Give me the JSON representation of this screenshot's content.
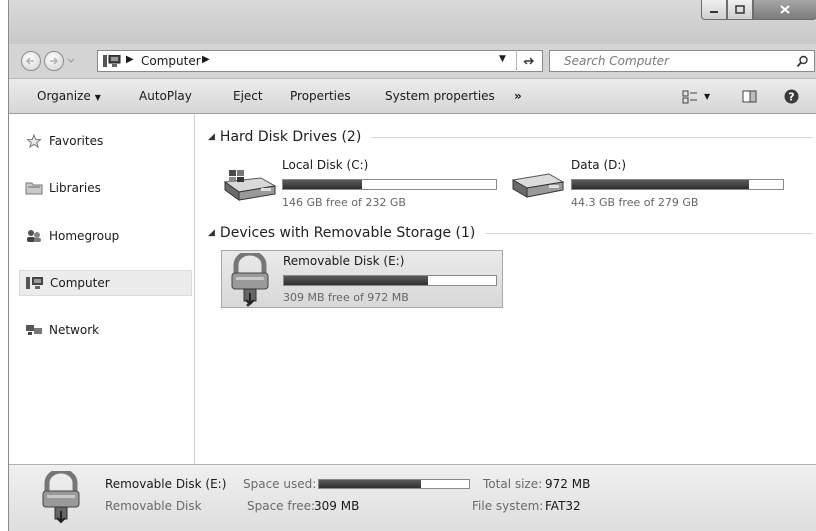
{
  "address_bar": {
    "path": [
      "Computer"
    ],
    "search_placeholder": "Search Computer"
  },
  "toolbar": {
    "organize": "Organize",
    "autoplay": "AutoPlay",
    "eject": "Eject",
    "properties": "Properties",
    "system_properties": "System properties",
    "more": "»"
  },
  "sidebar": {
    "items": [
      {
        "label": "Favorites",
        "icon": "star-icon"
      },
      {
        "label": "Libraries",
        "icon": "library-icon"
      },
      {
        "label": "Homegroup",
        "icon": "homegroup-icon"
      },
      {
        "label": "Computer",
        "icon": "computer-icon",
        "selected": true
      },
      {
        "label": "Network",
        "icon": "network-icon"
      }
    ]
  },
  "groups": [
    {
      "title": "Hard Disk Drives (2)",
      "drives": [
        {
          "name": "Local Disk (C:)",
          "free_text": "146 GB free of 232 GB",
          "used_fraction": 0.37,
          "icon": "windows-drive-icon"
        },
        {
          "name": "Data (D:)",
          "free_text": "44.3 GB free of 279 GB",
          "used_fraction": 0.84,
          "icon": "hard-drive-icon"
        }
      ]
    },
    {
      "title": "Devices with Removable Storage (1)",
      "drives": [
        {
          "name": "Removable Disk (E:)",
          "free_text": "309 MB free of 972 MB",
          "used_fraction": 0.68,
          "icon": "locked-usb-drive-icon",
          "selected": true
        }
      ]
    }
  ],
  "details": {
    "name": "Removable Disk (E:)",
    "type": "Removable Disk",
    "space_used_label": "Space used:",
    "space_free_label": "Space free:",
    "space_free_value": "309 MB",
    "total_size_label": "Total size:",
    "total_size_value": "972 MB",
    "file_system_label": "File system:",
    "file_system_value": "FAT32",
    "used_fraction": 0.68
  }
}
